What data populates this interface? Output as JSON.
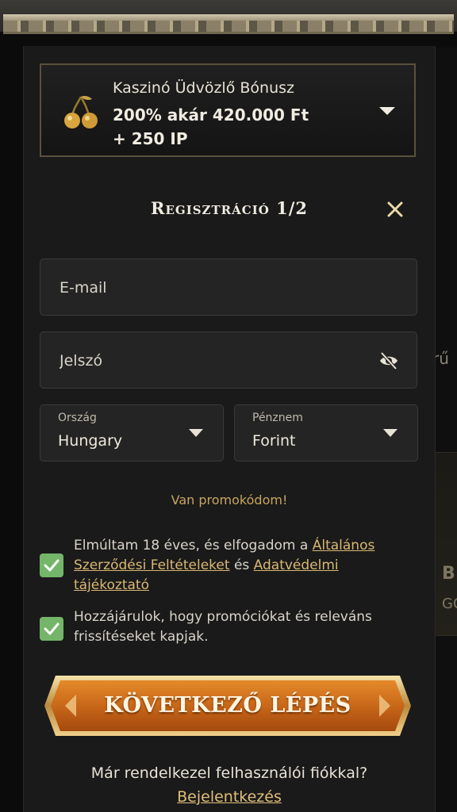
{
  "bonus": {
    "title": "Kaszinó Üdvözlő Bónusz",
    "amount_line1": "200% akár 420.000 Ft",
    "amount_line2": "+ 250 IP",
    "icon": "cherry-icon"
  },
  "registration": {
    "title": "Regisztráció 1/2",
    "email_placeholder": "E-mail",
    "password_placeholder": "Jelszó",
    "country_label": "Ország",
    "country_value": "Hungary",
    "currency_label": "Pénznem",
    "currency_value": "Forint",
    "promo_link": "Van promokódom!"
  },
  "consents": {
    "terms_prefix": "Elmúltam 18 éves, és elfogadom a ",
    "terms_link": "Általános Szerződési Feltételeket",
    "terms_mid": " és ",
    "privacy_link": "Adatvédelmi tájékoztató",
    "marketing_text": "Hozzájárulok, hogy promóciókat és releváns frissítéseket kapjak.",
    "terms_checked": true,
    "marketing_checked": true
  },
  "cta": {
    "next_label": "KÖVETKEZŐ LÉPÉS"
  },
  "footer": {
    "question": "Már rendelkezel felhasználói fiókkal?",
    "login_link": "Bejelentkezés"
  },
  "background": {
    "peek_text": "rű",
    "card_text1": "B",
    "card_text2": "GO"
  },
  "colors": {
    "accent_gold": "#c9a460",
    "checkbox_green": "#74b56a",
    "cta_orange": "#c9711f",
    "modal_bg": "#1a1a1a"
  }
}
